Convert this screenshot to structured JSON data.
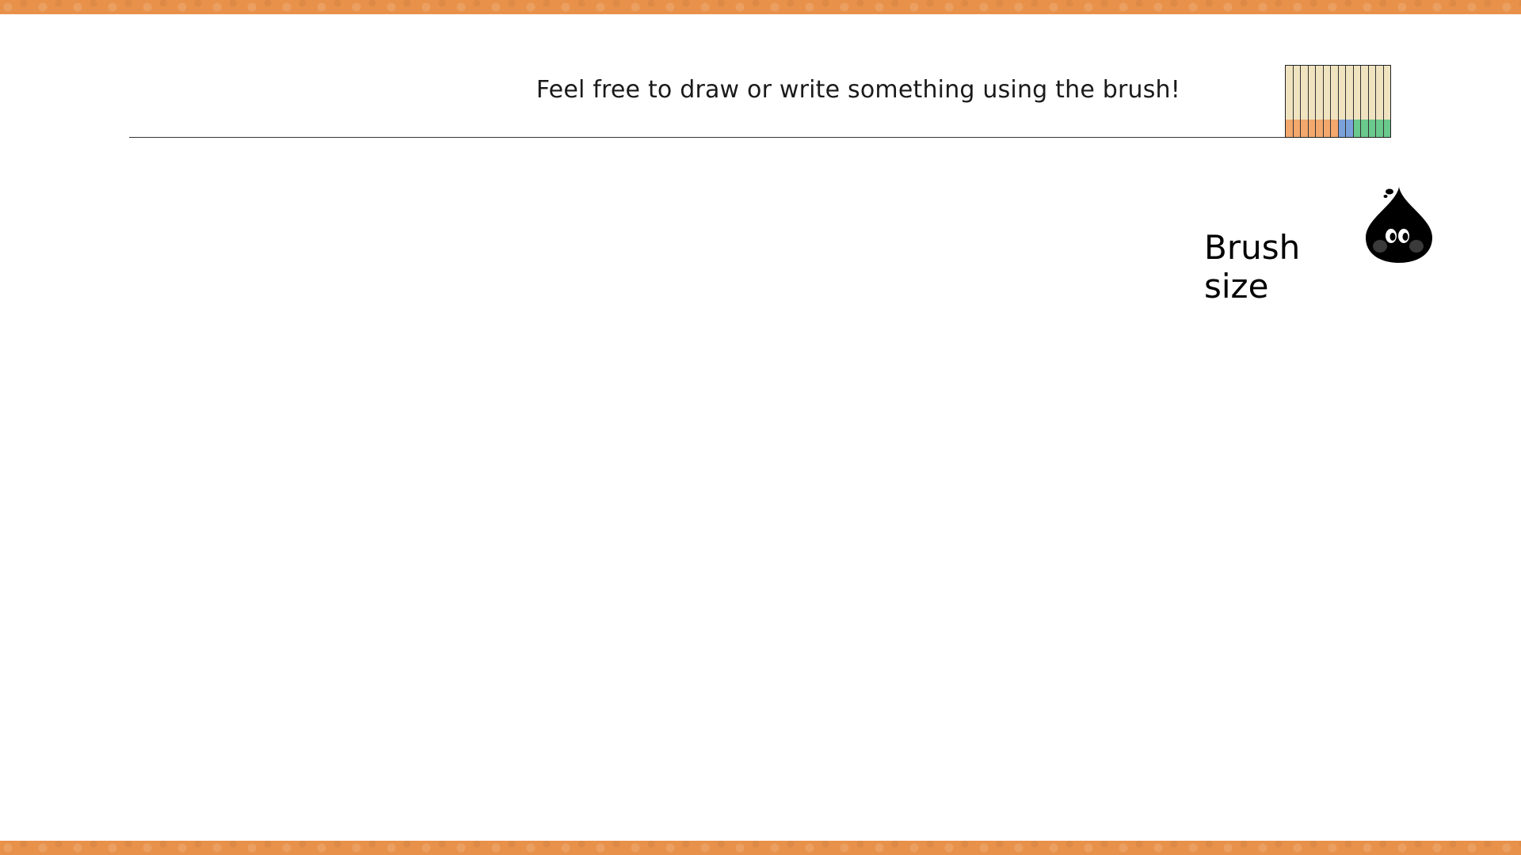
{
  "header": {
    "instruction": "Feel free to draw or write something using the brush!"
  },
  "palette": {
    "swatches": [
      {
        "tip": "#f3a86d"
      },
      {
        "tip": "#f3a86d"
      },
      {
        "tip": "#f3a86d"
      },
      {
        "tip": "#f3a86d"
      },
      {
        "tip": "#f3a86d"
      },
      {
        "tip": "#f3a86d"
      },
      {
        "tip": "#f3a86d"
      },
      {
        "tip": "#7ba1da"
      },
      {
        "tip": "#7ba1da"
      },
      {
        "tip": "#6ac98c"
      },
      {
        "tip": "#6ac98c"
      },
      {
        "tip": "#6ac98c"
      },
      {
        "tip": "#6ac98c"
      },
      {
        "tip": "#6ac98c"
      }
    ],
    "body_color": "#efe3c0"
  },
  "brush": {
    "label": "Brush size",
    "icon": "ink-drop-icon"
  },
  "colors": {
    "accent": "#e8914a",
    "line": "#333333"
  }
}
